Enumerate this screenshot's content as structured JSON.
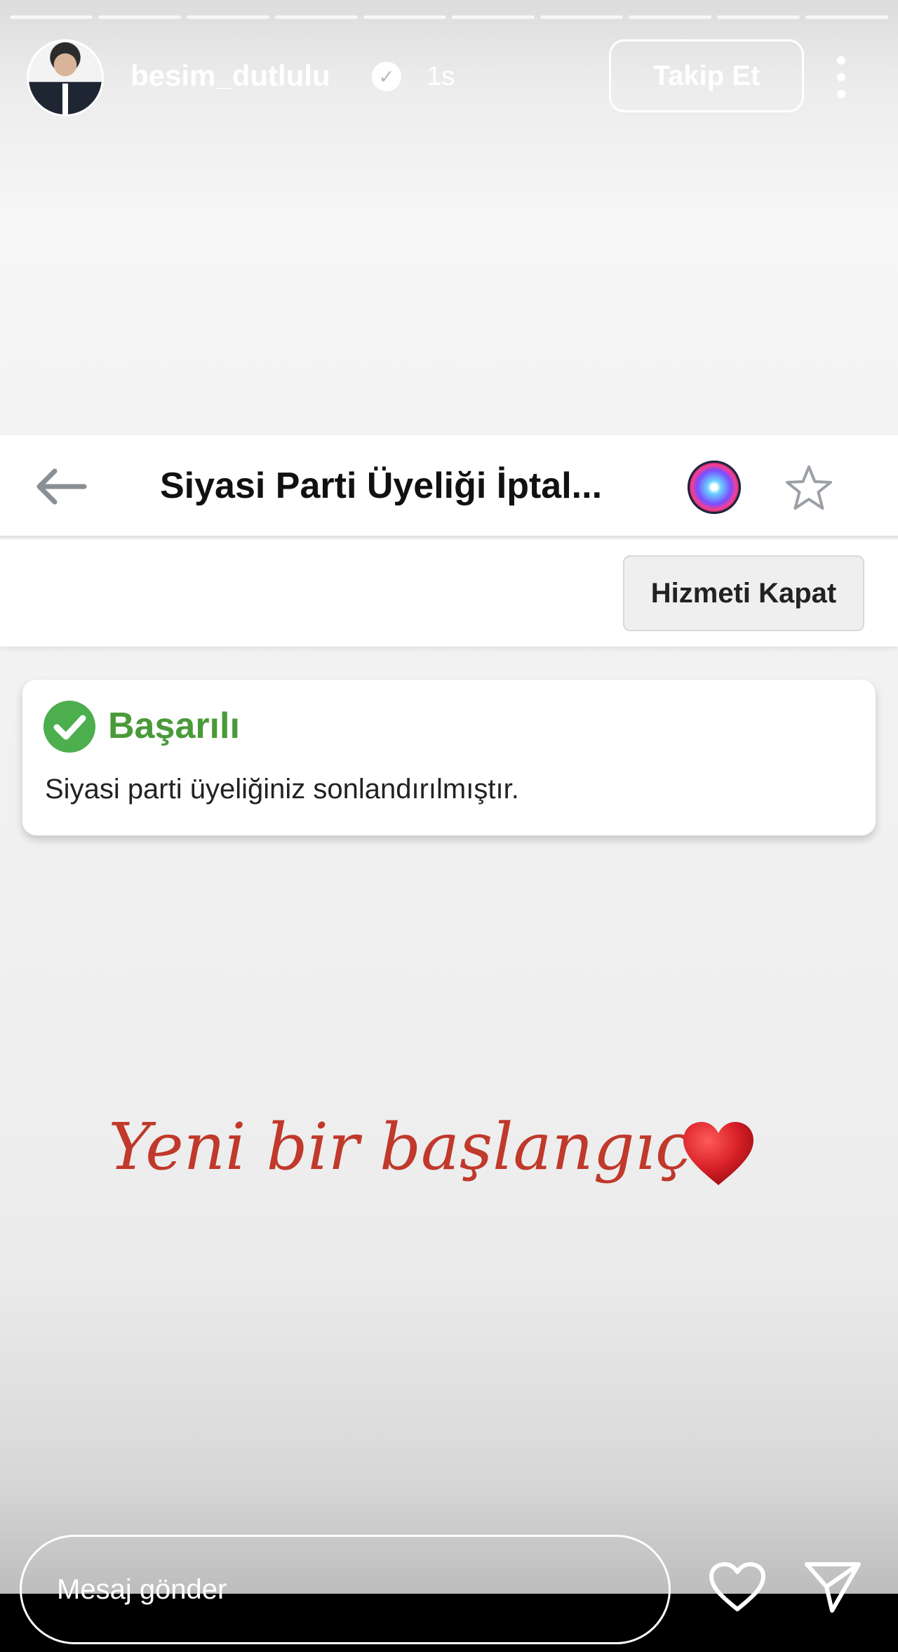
{
  "story": {
    "progress_segments": 10,
    "username": "besim_dutlulu",
    "time": "1s",
    "follow_label": "Takip Et"
  },
  "page": {
    "title": "Siyasi Parti Üyeliği İptal...",
    "close_service_label": "Hizmeti Kapat"
  },
  "alert": {
    "title": "Başarılı",
    "message": "Siyasi parti üyeliğiniz sonlandırılmıştır."
  },
  "caption": "Yeni bir başlangıç",
  "composer": {
    "placeholder": "Mesaj gönder"
  },
  "colors": {
    "success": "#4cae4c",
    "caption": "#c0392b"
  }
}
